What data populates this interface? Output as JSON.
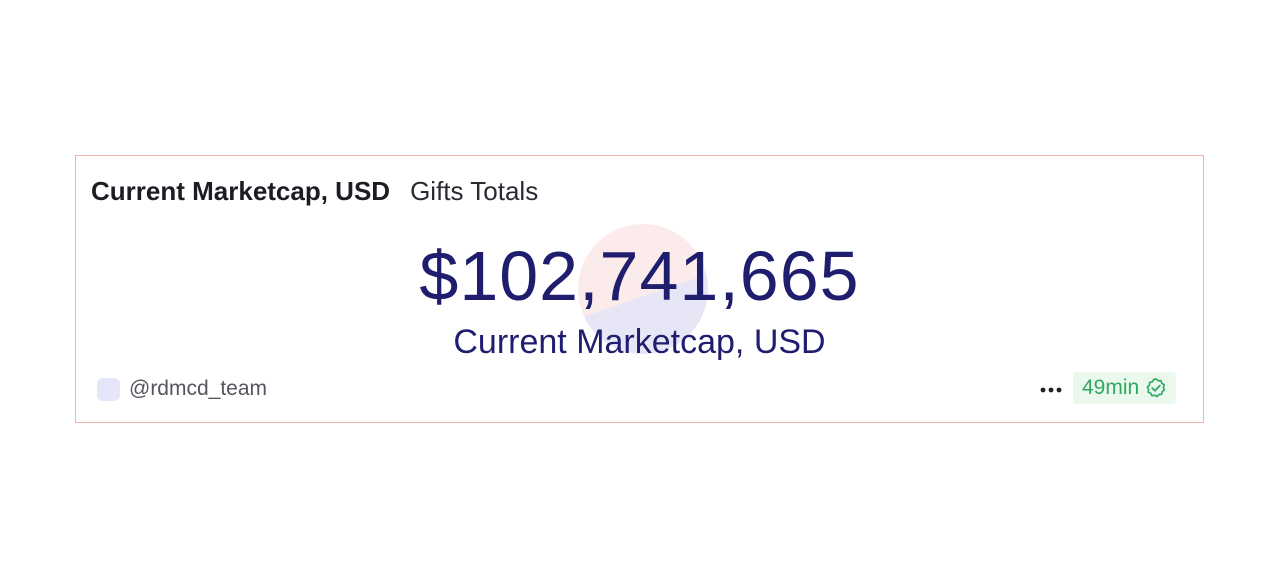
{
  "card": {
    "tabs": [
      {
        "label": "Current Marketcap, USD",
        "active": true
      },
      {
        "label": "Gifts Totals",
        "active": false
      }
    ],
    "metric": {
      "value": "$102,741,665",
      "label": "Current Marketcap, USD"
    },
    "footer": {
      "author": "@rdmcd_team",
      "more_icon": "more-dots-icon",
      "freshness": "49min",
      "freshness_icon": "verified-check-icon"
    }
  },
  "colors": {
    "card_border": "#f2b6a0",
    "metric_text": "#1f1d6e",
    "badge_text": "#2ea960",
    "badge_bg": "#eaf8ee",
    "avatar_bg": "#e6e6fb"
  }
}
